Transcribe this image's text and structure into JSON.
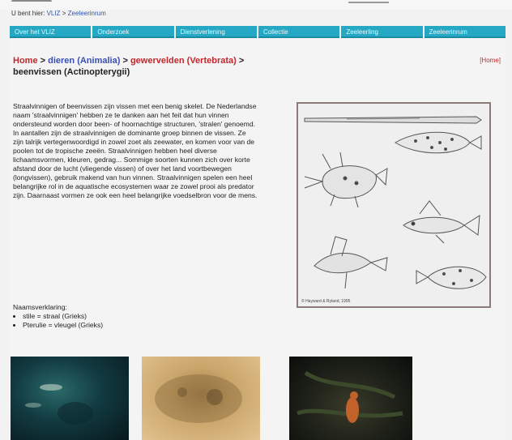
{
  "top": {
    "breadcrumb_prefix": "U bent hier:",
    "breadcrumb_home": "VLIZ",
    "breadcrumb_sep": ">",
    "breadcrumb_current": "Zeeleerinrum"
  },
  "nav": {
    "tabs": [
      "Over het VLIZ",
      "Onderzoek",
      "Dienstverlening",
      "Collectie",
      "Zeeleerling",
      "Zeeleerinrum"
    ]
  },
  "crumb": {
    "home": "Home",
    "sep": ">",
    "level1_name": "dieren",
    "level1_latin": "(Animalia)",
    "level2_name": "gewervelden",
    "level2_latin": "(Vertebrata)",
    "level3": "beenvissen (Actinopterygii)"
  },
  "home_link": "[Home]",
  "paragraph": "Straalvinnigen of beenvissen zijn vissen met een benig skelet. De Nederlandse naam 'straalvinnigen' hebben ze te danken aan het feit dat hun vinnen ondersteund worden door been- of hoornachtige structuren, 'stralen' genoemd. In aantallen zijn de straalvinnigen de dominante groep binnen de vissen. Ze zijn talrijk vertegenwoordigd in zowel zoet als zeewater, en komen voor van de poolen tot de tropische zeeën. Straalvinnigen hebben heel diverse lichaamsvormen, kleuren, gedrag... Sommige soorten kunnen zich over korte afstand door de lucht (vliegende vissen) of over het land voortbewegen (longvissen), gebruik makend van hun vinnen. Straalvinnigen spelen een heel belangrijke rol in de aquatische ecosystemen waar ze zowel prooi als predator zijn. Daarnaast vormen ze ook een heel belangrijke voedselbron voor de mens.",
  "names": {
    "heading": "Naamsverklaring:",
    "items": [
      "stile = straal (Grieks)",
      "Pterulie = vleugel (Grieks)"
    ]
  },
  "illustration": {
    "caption": "© Hayward & Ryland, 1995"
  },
  "colors": {
    "nav_bg": "#25a8c4",
    "crumb_red": "#c1272d",
    "crumb_blue": "#3a4fb0"
  }
}
